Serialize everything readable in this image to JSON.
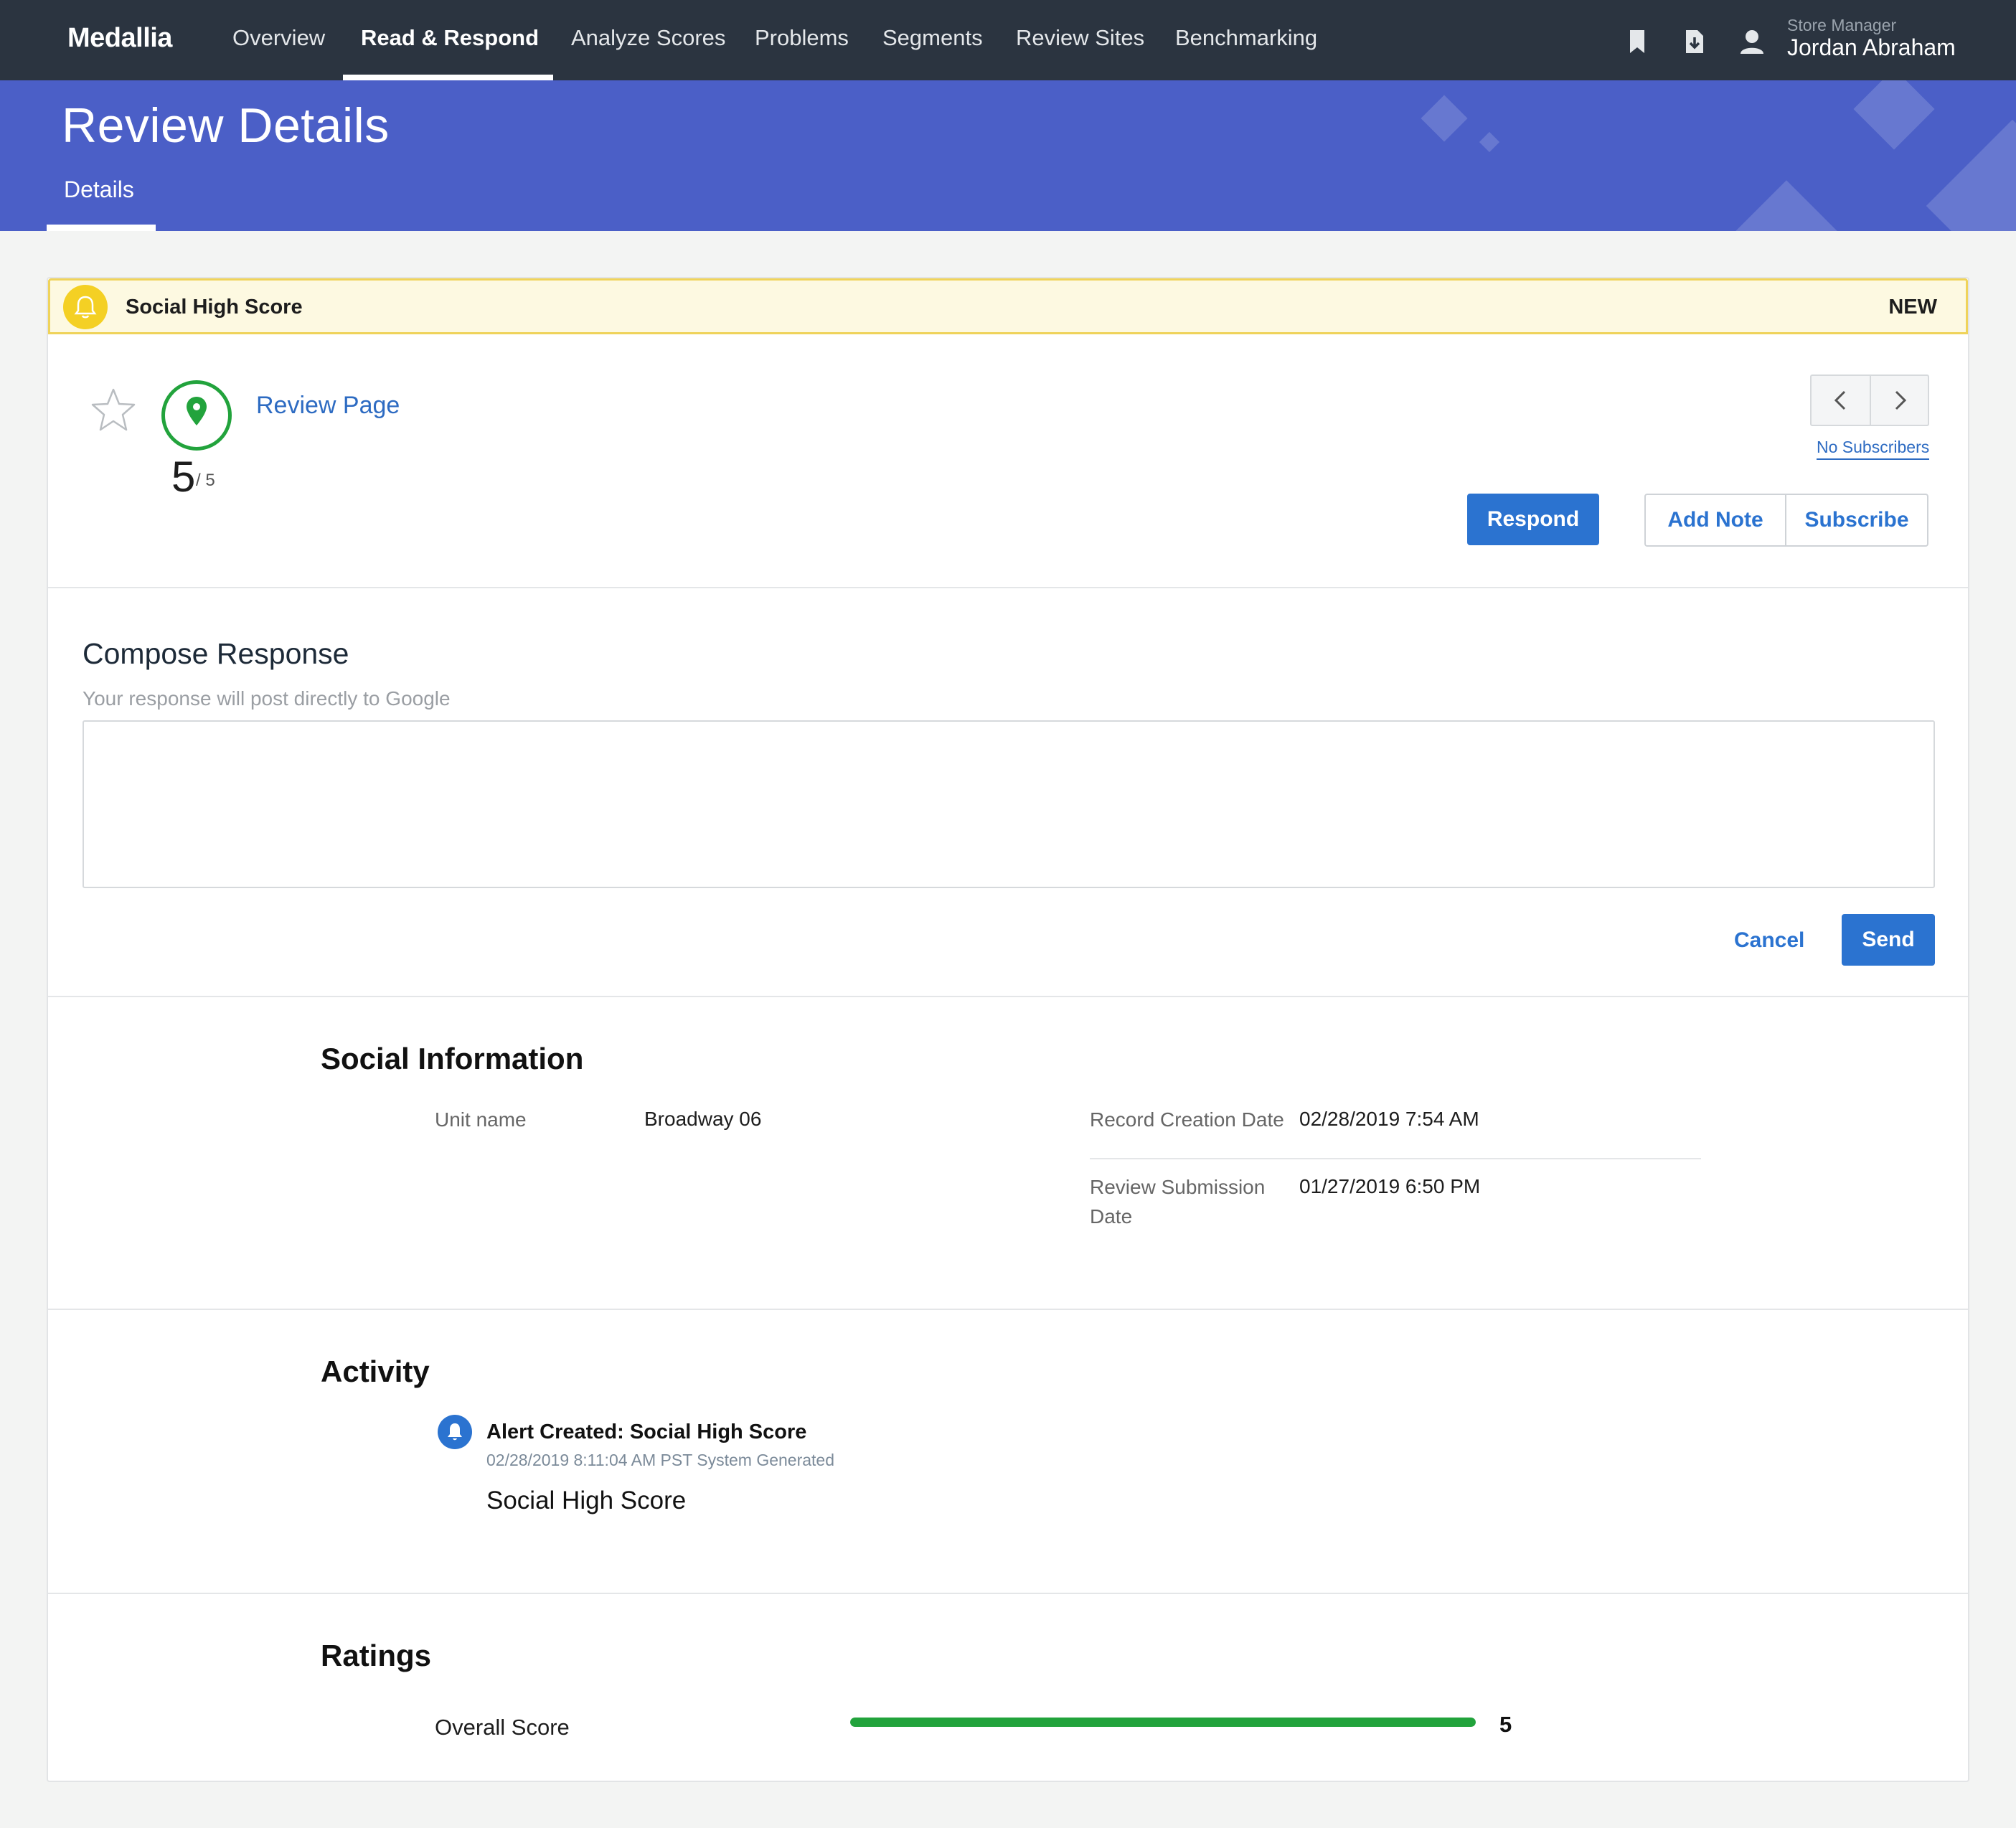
{
  "app": {
    "brand": "Medallia"
  },
  "nav": {
    "items": [
      {
        "label": "Overview"
      },
      {
        "label": "Read & Respond"
      },
      {
        "label": "Analyze Scores"
      },
      {
        "label": "Problems"
      },
      {
        "label": "Segments"
      },
      {
        "label": "Review Sites"
      },
      {
        "label": "Benchmarking"
      }
    ],
    "active": "Read & Respond",
    "icons": [
      "bookmark-icon",
      "download-icon",
      "user-icon"
    ]
  },
  "user": {
    "role": "Store Manager",
    "name": "Jordan Abraham"
  },
  "header": {
    "title": "Review Details",
    "tab": "Details"
  },
  "alert": {
    "title": "Social High Score",
    "status": "NEW",
    "icon": "bell-icon",
    "color": "#f4d024"
  },
  "review": {
    "score": "5",
    "score_max": "/ 5",
    "source_icon": "map-pin-icon",
    "link_label": "Review Page",
    "subscribers_label": "No Subscribers",
    "pager_icons": [
      "chevron-left-icon",
      "chevron-right-icon"
    ]
  },
  "actions": {
    "respond": "Respond",
    "add_note": "Add Note",
    "subscribe": "Subscribe"
  },
  "compose": {
    "title": "Compose Response",
    "subtitle": "Your response will post directly to Google",
    "value": "",
    "cancel": "Cancel",
    "send": "Send"
  },
  "social_info": {
    "title": "Social Information",
    "unit_label": "Unit name",
    "unit_value": "Broadway 06",
    "creation_label": "Record Creation Date",
    "creation_value": "02/28/2019 7:54 AM",
    "submission_label": "Review Submission Date",
    "submission_value": "01/27/2019 6:50 PM"
  },
  "activity": {
    "title": "Activity",
    "items": [
      {
        "title": "Alert Created: Social High Score",
        "meta": "02/28/2019 8:11:04 AM PST System Generated",
        "body": "Social High Score"
      }
    ]
  },
  "ratings": {
    "title": "Ratings",
    "items": [
      {
        "label": "Overall Score",
        "value": "5",
        "fraction": 1.0
      }
    ]
  },
  "colors": {
    "nav_bg": "#2b3440",
    "header_bg": "#4b5fc7",
    "accent": "#2b73d0",
    "success": "#22a33c"
  }
}
